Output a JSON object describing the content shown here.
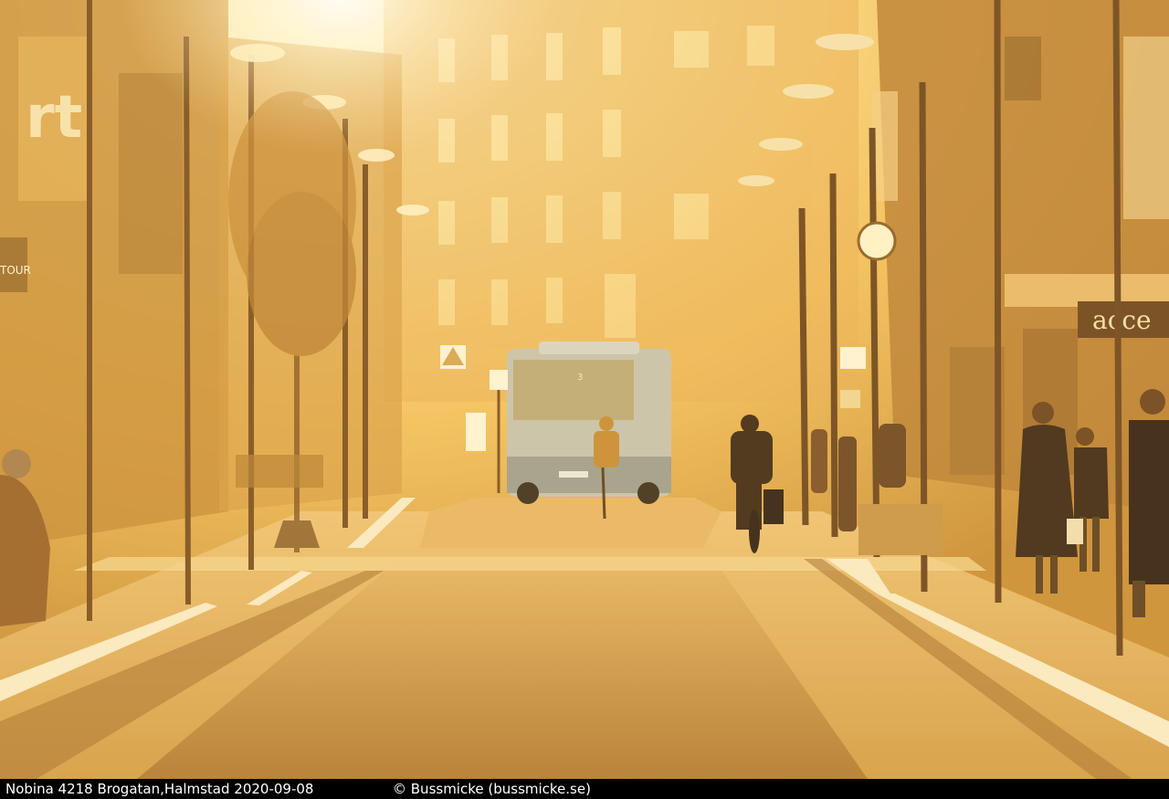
{
  "caption": {
    "left": "Nobina 4218 Brogatan,Halmstad 2020-09-08",
    "right": "© Bussmicke (bussmicke.se)"
  },
  "scene": {
    "bus_display": "3",
    "shop_sign_right": "acce",
    "sign_left_fragment": "rt",
    "sign_left_small": "TOUR",
    "colors": {
      "sun": "#fffbe0",
      "haze": "#f6c24a",
      "shadow": "#7a4e14",
      "pavement": "#e0a848",
      "road": "#b9822f"
    }
  }
}
